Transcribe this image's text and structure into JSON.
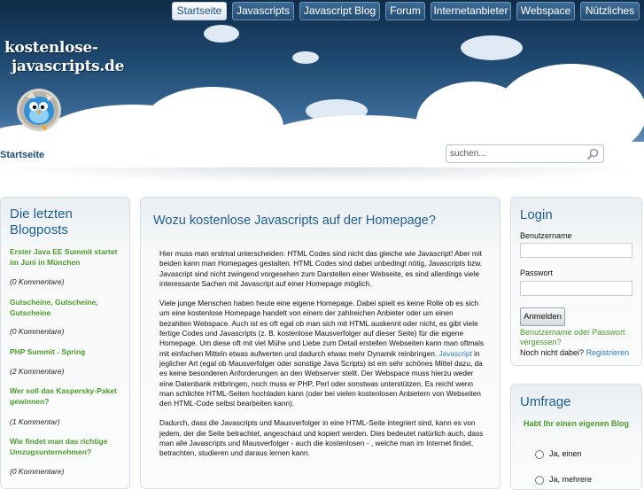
{
  "nav": {
    "items": [
      {
        "label": "Startseite",
        "active": true
      },
      {
        "label": "Javascripts",
        "active": false
      },
      {
        "label": "Javascript Blog",
        "active": false
      },
      {
        "label": "Forum",
        "active": false
      },
      {
        "label": "Internetanbieter",
        "active": false
      },
      {
        "label": "Webspace",
        "active": false
      },
      {
        "label": "Nützliches",
        "active": false
      }
    ]
  },
  "site": {
    "logo_line1": "kostenlose-",
    "logo_line2": "javascripts.de",
    "mascot_icon": "blue-bird-icon"
  },
  "breadcrumb": "Startseite",
  "search": {
    "placeholder": "suchen...",
    "icon": "magnifier-icon"
  },
  "sidebar": {
    "title": "Die letzten Blogposts",
    "posts": [
      {
        "title": "Erster Java EE Summit startet im Juni in München",
        "comments": "(0 Kommentare)"
      },
      {
        "title": "Gutscheine, Gutscheine, Gutscheine",
        "comments": "(0 Kommentare)"
      },
      {
        "title": "PHP Summit - Spring",
        "comments": "(2 Kommentare)"
      },
      {
        "title": "Wer soll das Kaspersky-Paket gewinnen?",
        "comments": "(1 Kommentar)"
      },
      {
        "title": "Wie findet man das richtige Umzugsunternehmen?",
        "comments": "(0 Kommentare)"
      }
    ]
  },
  "article": {
    "title": "Wozu kostenlose Javascripts auf der Homepage?",
    "p1": "Hier muss man erstmal unterscheiden: HTML Codes sind nicht das gleiche wie Javascript! Aber mit beiden kann man Homepages gestalten. HTML Codes sind dabei unbedingt nötig, Javascripts bzw. Javascript sind nicht zwingend vorgesehen zum Darstellen einer Webseite, es sind allerdings viele interessante Sachen mit Javascript auf einer Homepage möglich.",
    "p2_before": "Viele junge Menschen haben heute eine eigene Homepage. Dabei spielt es keine Rolle ob es sich um eine kostenlose Homepage handelt von einem der zahlreichen Anbieter oder um einen bezahlten Webspace. Auch ist es oft egal ob man sich mit HTML auskennt oder nicht, es gibt viele fertige Codes und Javascripts (z. B. kostenlose Mausverfolger auf dieser Seite) für die eigene Homepage. Um diese oft mit viel Mühe und Liebe zum Detail erstellen Webseiten kann man oftmals mit einfachen Mitteln etwas aufwerten und dadurch etwas mehr Dynamik reinbringen.",
    "p2_link": "Javascript",
    "p2_after": "in jeglicher Art (egal ob Mausverfolger oder sonstige Java Scripts) ist ein sehr schönes Mittel dazu, da es keine besonderen Anforderungen an den Webserver stellt. Der Webspace muss hierzu weder eine Datenbank mitbringen, noch muss er PHP, Perl oder sonstwas unterstützen. Es reicht wenn man schlichte HTML-Seiten hochladen kann (oder bei vielen kostenlosen Anbietern von Webseiten den HTML-Code selbst bearbeiten kann).",
    "p3": "Dadurch, dass die Javascripts und Mausverfolger in eine HTML-Seite integriert sind, kann es von jedem, der die Seite betrachtet, angeschaut und kopiert werden. Dies bedeutet natürlich auch, dass man alle Javascripts und Mausverfolger - auch die kostenlosen - , welche man im Internet findet, betrachten, studieren und daraus lernen kann."
  },
  "login": {
    "title": "Login",
    "username_label": "Benutzername",
    "password_label": "Passwort",
    "submit": "Anmelden",
    "forgot": "Benutzername oder Passwort vergessen?",
    "register_prompt": "Noch nicht dabei?",
    "register_link": "Registrieren"
  },
  "poll": {
    "title": "Umfrage",
    "question": "Habt Ihr einen eigenen Blog",
    "options": [
      "Ja, einen",
      "Ja, mehrere"
    ]
  },
  "colors": {
    "accent_blue": "#1d5f92",
    "link_green": "#4b9a28",
    "link_blue": "#2b7ab8"
  }
}
